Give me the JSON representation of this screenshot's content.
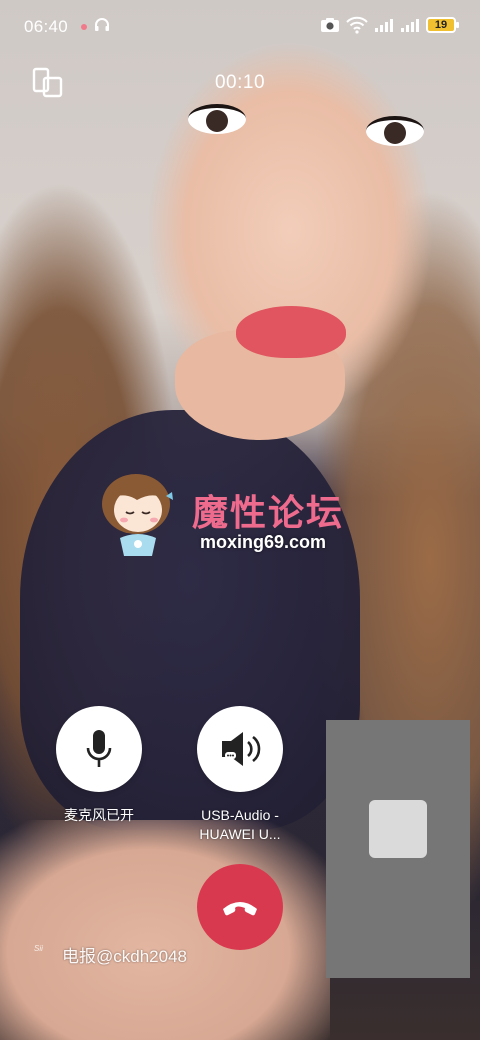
{
  "status_bar": {
    "time": "06:40",
    "battery": "19",
    "icons": [
      "notification-dot",
      "headset-icon",
      "camera-icon",
      "wifi-icon",
      "signal-icon",
      "signal-icon",
      "battery-icon"
    ]
  },
  "call": {
    "duration": "00:10"
  },
  "watermark": {
    "title": "魔性论坛",
    "url": "moxing69.com",
    "bottom_text": "电报@ckdh2048",
    "small_mark": "Sii"
  },
  "controls": {
    "mic_label": "麦克风已开",
    "audio_label_line1": "USB-Audio -",
    "audio_label_line2": "HUAWEI U..."
  },
  "colors": {
    "hangup": "#d9394f",
    "watermark_pink": "#ef6b8d",
    "preview_bg": "#767676"
  }
}
